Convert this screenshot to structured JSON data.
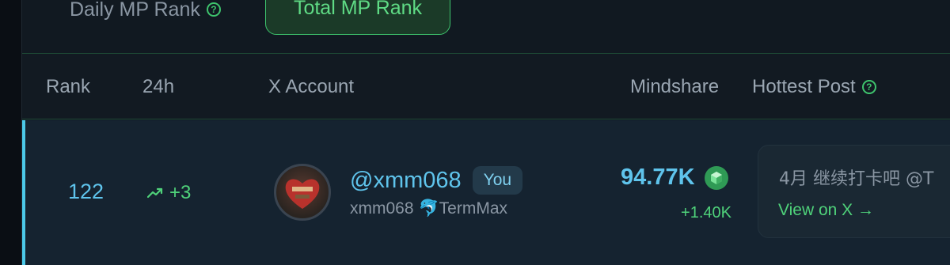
{
  "tabs": {
    "daily_label": "Daily MP Rank",
    "total_label": "Total MP Rank",
    "active": "Total MP Rank"
  },
  "columns": {
    "rank": "Rank",
    "change_24h": "24h",
    "x_account": "X Account",
    "mindshare": "Mindshare",
    "hottest_post": "Hottest Post"
  },
  "row": {
    "rank": "122",
    "change_24h": "+3",
    "handle": "@xmm068",
    "you_badge": "You",
    "display_name": "xmm068",
    "affiliation": "🐬TermMax",
    "mindshare": "94.77K",
    "mindshare_change": "+1.40K",
    "hottest_post_text": "4月 继续打卡吧 @T",
    "view_link": "View on X →"
  },
  "colors": {
    "accent_green": "#4fd27a",
    "accent_blue": "#5fc4ec",
    "background": "#121a22"
  },
  "icons": {
    "help": "question-circle-icon",
    "trend": "trending-up-icon",
    "mindshare": "cube-icon"
  }
}
